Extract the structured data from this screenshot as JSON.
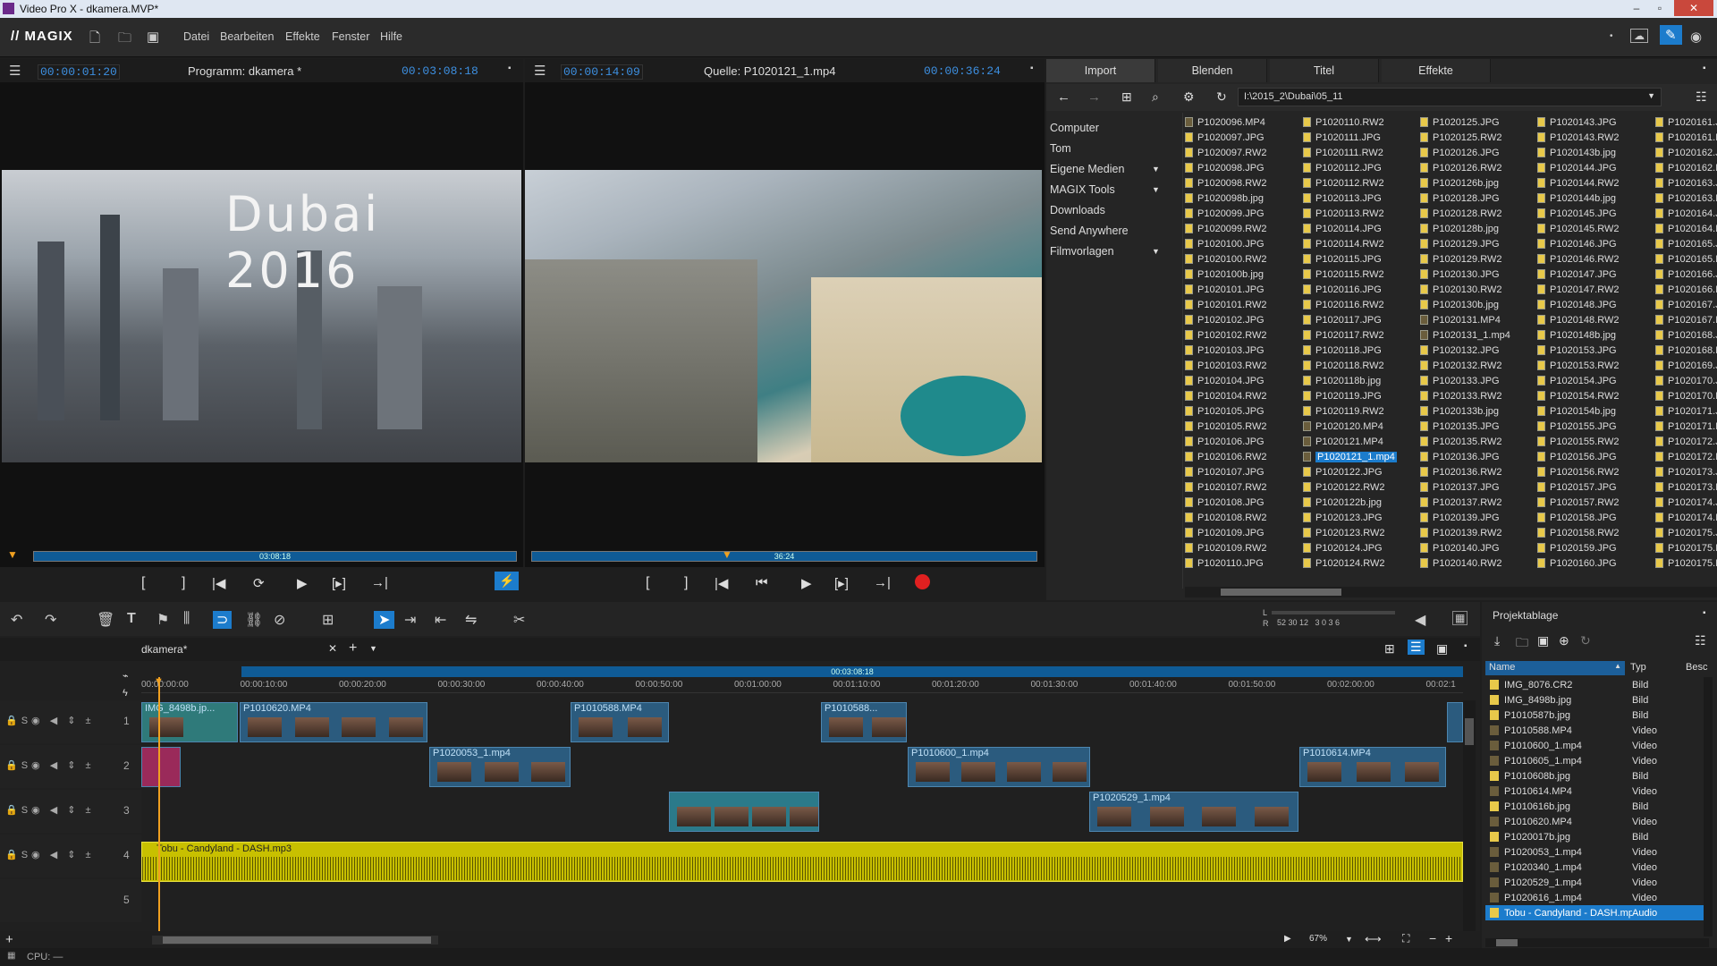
{
  "window": {
    "title": "Video Pro X - dkamera.MVP*"
  },
  "menubar": {
    "logo": "// MAGIX",
    "items": [
      "Datei",
      "Bearbeiten",
      "Effekte",
      "Fenster",
      "Hilfe"
    ]
  },
  "program_monitor": {
    "timecode_left": "00:00:01:20",
    "title": "Programm: dkamera *",
    "timecode_right": "00:03:08:18",
    "overlay_text": "Dubai 2016",
    "scrub_label": "03:08:18"
  },
  "source_monitor": {
    "timecode_left": "00:00:14:09",
    "title": "Quelle: P1020121_1.mp4",
    "timecode_right": "00:00:36:24",
    "scrub_label": "36:24"
  },
  "import": {
    "tabs": [
      "Import",
      "Blenden",
      "Titel",
      "Effekte"
    ],
    "path": "I:\\2015_2\\Dubai\\05_11",
    "nav": [
      "Computer",
      "Tom",
      "Eigene Medien",
      "MAGIX Tools",
      "Downloads",
      "Send Anywhere",
      "Filmvorlagen"
    ],
    "columns": [
      [
        "P1020096.MP4",
        "P1020097.JPG",
        "P1020097.RW2",
        "P1020098.JPG",
        "P1020098.RW2",
        "P1020098b.jpg",
        "P1020099.JPG",
        "P1020099.RW2",
        "P1020100.JPG",
        "P1020100.RW2",
        "P1020100b.jpg",
        "P1020101.JPG",
        "P1020101.RW2",
        "P1020102.JPG",
        "P1020102.RW2",
        "P1020103.JPG",
        "P1020103.RW2",
        "P1020104.JPG",
        "P1020104.RW2",
        "P1020105.JPG",
        "P1020105.RW2",
        "P1020106.JPG",
        "P1020106.RW2",
        "P1020107.JPG",
        "P1020107.RW2",
        "P1020108.JPG",
        "P1020108.RW2",
        "P1020109.JPG",
        "P1020109.RW2",
        "P1020110.JPG"
      ],
      [
        "P1020110.RW2",
        "P1020111.JPG",
        "P1020111.RW2",
        "P1020112.JPG",
        "P1020112.RW2",
        "P1020113.JPG",
        "P1020113.RW2",
        "P1020114.JPG",
        "P1020114.RW2",
        "P1020115.JPG",
        "P1020115.RW2",
        "P1020116.JPG",
        "P1020116.RW2",
        "P1020117.JPG",
        "P1020117.RW2",
        "P1020118.JPG",
        "P1020118.RW2",
        "P1020118b.jpg",
        "P1020119.JPG",
        "P1020119.RW2",
        "P1020120.MP4",
        "P1020121.MP4",
        "P1020121_1.mp4",
        "P1020122.JPG",
        "P1020122.RW2",
        "P1020122b.jpg",
        "P1020123.JPG",
        "P1020123.RW2",
        "P1020124.JPG",
        "P1020124.RW2"
      ],
      [
        "P1020125.JPG",
        "P1020125.RW2",
        "P1020126.JPG",
        "P1020126.RW2",
        "P1020126b.jpg",
        "P1020128.JPG",
        "P1020128.RW2",
        "P1020128b.jpg",
        "P1020129.JPG",
        "P1020129.RW2",
        "P1020130.JPG",
        "P1020130.RW2",
        "P1020130b.jpg",
        "P1020131.MP4",
        "P1020131_1.mp4",
        "P1020132.JPG",
        "P1020132.RW2",
        "P1020133.JPG",
        "P1020133.RW2",
        "P1020133b.jpg",
        "P1020135.JPG",
        "P1020135.RW2",
        "P1020136.JPG",
        "P1020136.RW2",
        "P1020137.JPG",
        "P1020137.RW2",
        "P1020139.JPG",
        "P1020139.RW2",
        "P1020140.JPG",
        "P1020140.RW2"
      ],
      [
        "P1020143.JPG",
        "P1020143.RW2",
        "P1020143b.jpg",
        "P1020144.JPG",
        "P1020144.RW2",
        "P1020144b.jpg",
        "P1020145.JPG",
        "P1020145.RW2",
        "P1020146.JPG",
        "P1020146.RW2",
        "P1020147.JPG",
        "P1020147.RW2",
        "P1020148.JPG",
        "P1020148.RW2",
        "P1020148b.jpg",
        "P1020153.JPG",
        "P1020153.RW2",
        "P1020154.JPG",
        "P1020154.RW2",
        "P1020154b.jpg",
        "P1020155.JPG",
        "P1020155.RW2",
        "P1020156.JPG",
        "P1020156.RW2",
        "P1020157.JPG",
        "P1020157.RW2",
        "P1020158.JPG",
        "P1020158.RW2",
        "P1020159.JPG",
        "P1020160.JPG"
      ],
      [
        "P1020161.JP",
        "P1020161.R",
        "P1020162.JP",
        "P1020162.R",
        "P1020163.JP",
        "P1020163.R",
        "P1020164.JP",
        "P1020164.R",
        "P1020165.JP",
        "P1020165.R",
        "P1020166.JP",
        "P1020166.R",
        "P1020167.JP",
        "P1020167.R",
        "P1020168.JP",
        "P1020168.R",
        "P1020169.JP",
        "P1020170.JP",
        "P1020170.R",
        "P1020171.JP",
        "P1020171.R",
        "P1020172.JP",
        "P1020172.R",
        "P1020173.JP",
        "P1020173.R",
        "P1020174.JP",
        "P1020174.R",
        "P1020175.JP",
        "P1020175.R",
        "P1020175.R"
      ]
    ],
    "selected_file": "P1020121_1.mp4"
  },
  "timeline": {
    "project_tab": "dkamera*",
    "duration_label": "00:03:08:18",
    "ruler": [
      "00:00:00:00",
      "00:00:10:00",
      "00:00:20:00",
      "00:00:30:00",
      "00:00:40:00",
      "00:00:50:00",
      "00:01:00:00",
      "00:01:10:00",
      "00:01:20:00",
      "00:01:30:00",
      "00:01:40:00",
      "00:01:50:00",
      "00:02:00:00",
      "00:02:1"
    ],
    "meter_labels": "52 30 12   3 0 3 6",
    "zoom": "67%",
    "track_numbers": [
      "1",
      "2",
      "3",
      "4",
      "5"
    ],
    "track1": [
      "IMG_8498b.jp...",
      "P1010620.MP4",
      "P1010588.MP4",
      "P1010588..."
    ],
    "track2": [
      "P1020053_1.mp4",
      "P1010600_1.mp4",
      "P1010614.MP4"
    ],
    "track3": [
      "P1020529_1.mp4"
    ],
    "audio": "Tobu - Candyland - DASH.mp3"
  },
  "bin": {
    "title": "Projektablage",
    "headers": {
      "name": "Name",
      "type": "Typ",
      "desc": "Besc"
    },
    "rows": [
      {
        "name": "IMG_8076.CR2",
        "type": "Bild"
      },
      {
        "name": "IMG_8498b.jpg",
        "type": "Bild"
      },
      {
        "name": "P1010587b.jpg",
        "type": "Bild"
      },
      {
        "name": "P1010588.MP4",
        "type": "Video"
      },
      {
        "name": "P1010600_1.mp4",
        "type": "Video"
      },
      {
        "name": "P1010605_1.mp4",
        "type": "Video"
      },
      {
        "name": "P1010608b.jpg",
        "type": "Bild"
      },
      {
        "name": "P1010614.MP4",
        "type": "Video"
      },
      {
        "name": "P1010616b.jpg",
        "type": "Bild"
      },
      {
        "name": "P1010620.MP4",
        "type": "Video"
      },
      {
        "name": "P1020017b.jpg",
        "type": "Bild"
      },
      {
        "name": "P1020053_1.mp4",
        "type": "Video"
      },
      {
        "name": "P1020340_1.mp4",
        "type": "Video"
      },
      {
        "name": "P1020529_1.mp4",
        "type": "Video"
      },
      {
        "name": "P1020616_1.mp4",
        "type": "Video"
      },
      {
        "name": "Tobu - Candyland - DASH.mp3",
        "type": "Audio"
      }
    ]
  },
  "status": {
    "cpu": "CPU: —"
  }
}
